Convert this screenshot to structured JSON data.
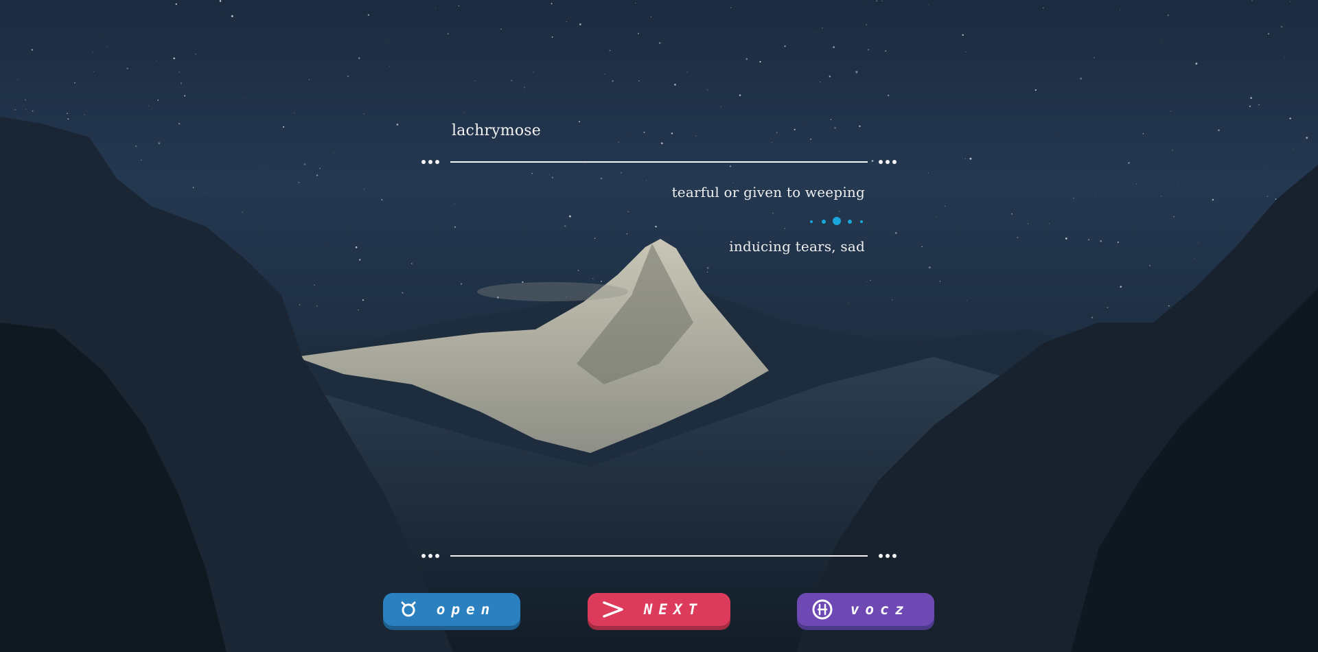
{
  "card": {
    "word": "lachrymose",
    "definitions": [
      "tearful or given to weeping",
      "inducing tears, sad"
    ]
  },
  "pager": {
    "count": 5,
    "active_index": 2,
    "color": "#1aa6dc"
  },
  "buttons": {
    "open": {
      "label": "open",
      "icon": "open-icon",
      "color": "#2b80bf"
    },
    "next": {
      "label": "NEXT",
      "icon": "next-arrow-icon",
      "color": "#dc3b5c"
    },
    "vocz": {
      "label": "vocz",
      "icon": "vocz-theta-icon",
      "color": "#6e49b3"
    }
  },
  "colors": {
    "sky": "#1c2b3f",
    "text": "#f2f2f2",
    "accent": "#1aa6dc"
  }
}
